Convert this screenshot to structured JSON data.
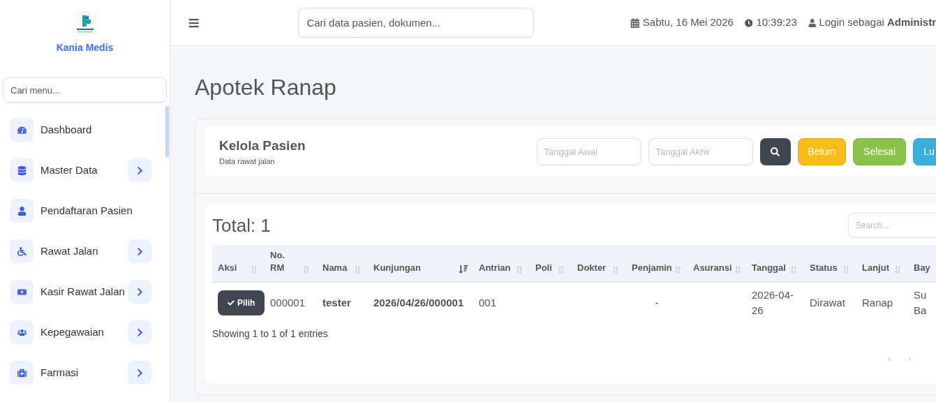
{
  "brand": {
    "name": "Kania Medis"
  },
  "sidebar": {
    "search": {
      "placeholder": "Cari menu..."
    },
    "items": [
      {
        "label": "Dashboard",
        "has_submenu": false
      },
      {
        "label": "Master Data",
        "has_submenu": true
      },
      {
        "label": "Pendaftaran Pasien",
        "has_submenu": false
      },
      {
        "label": "Rawat Jalan",
        "has_submenu": true
      },
      {
        "label": "Kasir Rawat Jalan",
        "has_submenu": true
      },
      {
        "label": "Kepegawaian",
        "has_submenu": true
      },
      {
        "label": "Farmasi",
        "has_submenu": true
      }
    ]
  },
  "topbar": {
    "search": {
      "placeholder": "Cari data pasien, dokumen..."
    },
    "date": "Sabtu, 16 Mei 2026",
    "time": "10:39:23",
    "login": "Login sebagai **Administr**"
  },
  "page_title": "Apotek Ranap",
  "filter_card": {
    "title": "Kelola Pasien",
    "subtitle": "Data rawat jalan",
    "start_date": {
      "placeholder": "Tanggal Awal"
    },
    "end_date": {
      "placeholder": "Tanggal Akhir"
    },
    "buttons": [
      {
        "kind": "search"
      },
      {
        "kind": "warning",
        "label": "Belum"
      },
      {
        "kind": "success",
        "label": "Selesai"
      },
      {
        "kind": "info",
        "label": "Lu"
      }
    ]
  },
  "table_card": {
    "total": "Total: 1",
    "search": {
      "placeholder": "Search..."
    },
    "columns": [
      {
        "label": "Aksi",
        "sorted": false
      },
      {
        "label": "No. RM",
        "sorted": false
      },
      {
        "label": "Nama",
        "sorted": false
      },
      {
        "label": "Kunjungan",
        "sorted": true
      },
      {
        "label": "Antrian",
        "sorted": false
      },
      {
        "label": "Poli",
        "sorted": false
      },
      {
        "label": "Dokter",
        "sorted": false
      },
      {
        "label": "Penjamin",
        "sorted": false
      },
      {
        "label": "Asuransi",
        "sorted": false
      },
      {
        "label": "Tanggal",
        "sorted": false
      },
      {
        "label": "Status",
        "sorted": false
      },
      {
        "label": "Lanjut",
        "sorted": false
      },
      {
        "label": "Bay"
      }
    ],
    "rows": [
      {
        "action": "Pilih",
        "no_rm": "000001",
        "nama": "tester",
        "kunjungan": "2026/04/26/000001",
        "antrian": "001",
        "penjamin": "-",
        "tanggal": "2026-04-26",
        "status": "Dirawat",
        "lanjut": "Ranap",
        "column_13": "Su Ba"
      }
    ],
    "info": "Showing 1 to 1 of 1 entries",
    "pagination": [
      {
        "label": "«",
        "disabled": true
      },
      {
        "label": "‹",
        "disabled": true
      }
    ]
  }
}
